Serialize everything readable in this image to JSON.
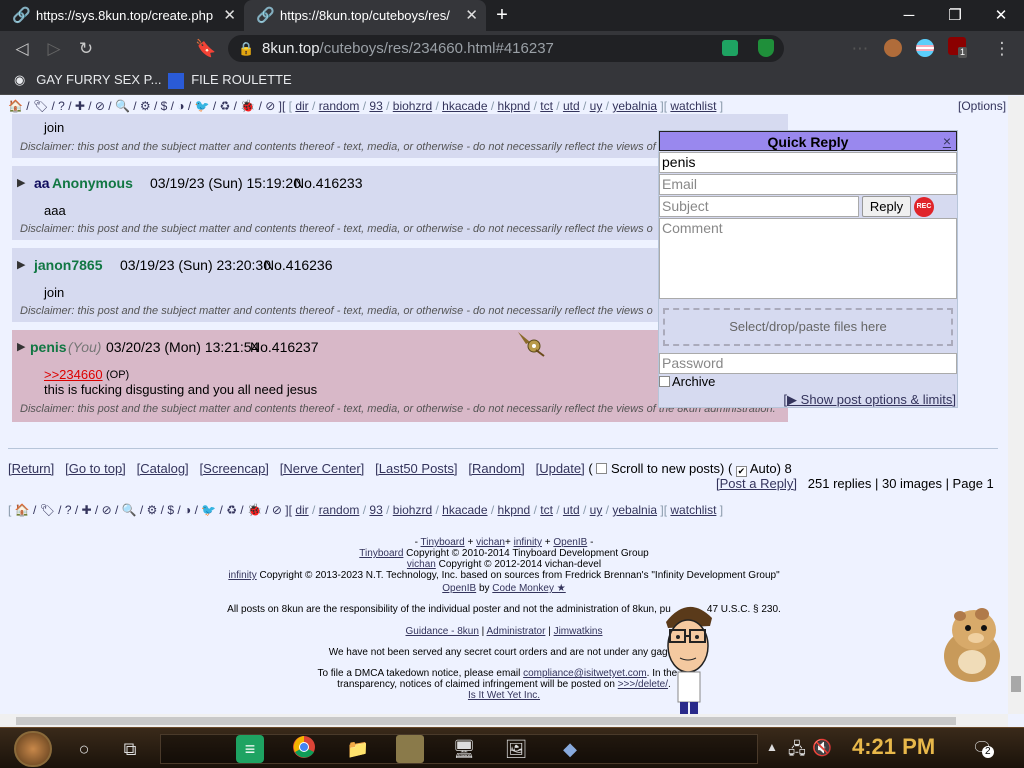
{
  "browser": {
    "tabs": [
      {
        "title": "https://sys.8kun.top/create.php",
        "close": "✕"
      },
      {
        "title": "https://8kun.top/cuteboys/res/",
        "close": "✕"
      }
    ],
    "new_tab": "+",
    "window_controls": {
      "minimize": "─",
      "restore": "❐",
      "close": "✕"
    },
    "url": {
      "host": "8kun.top",
      "path": "/cuteboys/res/234660.html#416237"
    },
    "extension_badge": "1",
    "bookmarks": [
      {
        "label": "GAY FURRY SEX P..."
      },
      {
        "label": "FILE ROULETTE"
      }
    ]
  },
  "boardlist": {
    "icons": "🏠 / 🏷 / ? / ✚ / ⊘ / 🔍 / ⚙ / $ / ◑ / 🐦 / ♻ / 🐞 / ⊘ ][",
    "boards": [
      "dir",
      "random",
      "93",
      "biohzrd",
      "hkacade",
      "hkpnd",
      "tct",
      "utd",
      "uy",
      "yebalnia"
    ],
    "watchlist": "watchlist",
    "options": "[Options]"
  },
  "posts": [
    {
      "body": "join",
      "disclaimer": "Disclaimer: this post and the subject matter and contents thereof - text, media, or otherwise - do not necessarily reflect the views of"
    },
    {
      "subject": "aa",
      "name": "Anonymous",
      "date": "03/19/23 (Sun) 15:19:20",
      "no": "No.416233",
      "body": "aaa",
      "disclaimer": "Disclaimer: this post and the subject matter and contents thereof - text, media, or otherwise - do not necessarily reflect the views o"
    },
    {
      "name": "janon7865",
      "date": "03/19/23 (Sun) 23:20:30",
      "no": "No.416236",
      "body": "join",
      "disclaimer": "Disclaimer: this post and the subject matter and contents thereof - text, media, or otherwise - do not necessarily reflect the views o"
    },
    {
      "name": "penis",
      "you": "(You)",
      "date": "03/20/23 (Mon) 13:21:54",
      "no": "No.416237",
      "quote": ">>234660",
      "op": "(OP)",
      "body": "this is fucking disgusting and you all need jesus",
      "disclaimer": "Disclaimer: this post and the subject matter and contents thereof - text, media, or otherwise - do not necessarily reflect the views of the 8kun administration."
    }
  ],
  "quick_reply": {
    "title": "Quick Reply",
    "close": "×",
    "name_value": "penis",
    "email_placeholder": "Email",
    "subject_placeholder": "Subject",
    "reply_button": "Reply",
    "rec": "REC",
    "comment_placeholder": "Comment",
    "file_drop": "Select/drop/paste files here",
    "password_placeholder": "Password",
    "archive_label": "Archive",
    "options_link": "[▶ Show post options & limits]"
  },
  "thread_nav": {
    "links": [
      "[Return]",
      "[Go to top]",
      "[Catalog]",
      "[Screencap]",
      "[Nerve Center]",
      "[Last50 Posts]",
      "[Random]",
      "[Update]"
    ],
    "scroll_label": "Scroll to new posts)",
    "auto_label": "Auto) 8",
    "post_reply": "[Post a Reply]",
    "stats": "251 replies | 30 images | Page 1"
  },
  "footer": {
    "line1": [
      "-",
      "Tinyboard",
      "+",
      "vichan",
      "+",
      "infinity",
      "+",
      "OpenIB",
      "-"
    ],
    "line2_link": "Tinyboard",
    "line2_text": " Copyright © 2010-2014 Tinyboard Development Group",
    "line3_link": "vichan",
    "line3_text": " Copyright © 2012-2014 vichan-devel",
    "line4_link": "infinity",
    "line4_text": " Copyright © 2013-2023 N.T. Technology, Inc. based on sources from Fredrick Brennan's \"Infinity Development Group\"",
    "line5_link1": "OpenIB",
    "line5_mid": " by ",
    "line5_link2": "Code Monkey ★",
    "line6": "All posts on 8kun are the responsibility of the individual poster and not the administration of 8kun, pu",
    "line6_end": "47 U.S.C. § 230.",
    "line7": [
      "Guidance - 8kun",
      "Administrator",
      "Jimwatkins"
    ],
    "line8": "We have not been served any secret court orders and are not under any gag or",
    "line9_text": "To file a DMCA takedown notice, please email ",
    "line9_link": "compliance@isitwetyet.com",
    "line9_end": ". In the int",
    "line10_text": "transparency, notices of claimed infringement will be posted on ",
    "line10_link": ">>>/delete/",
    "line10_end": ".",
    "line11": "Is It Wet Yet Inc."
  },
  "taskbar": {
    "clock": "4:21 PM",
    "notify_badge": "2"
  }
}
